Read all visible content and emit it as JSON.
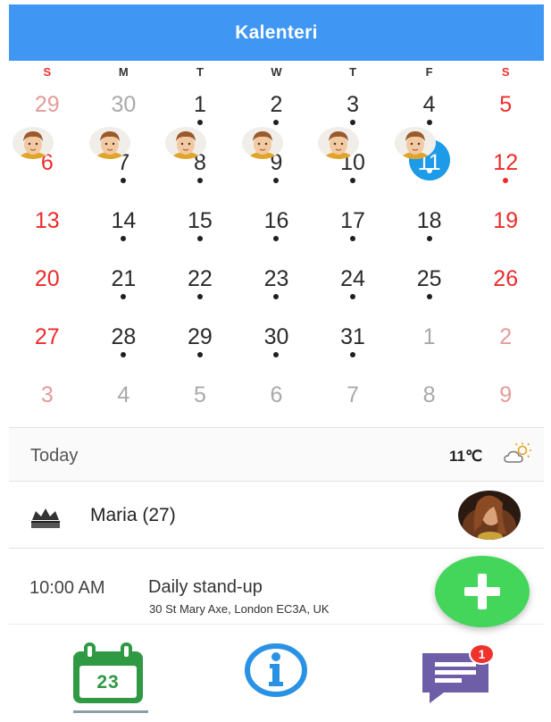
{
  "app": {
    "title": "Kalenteri"
  },
  "colors": {
    "appbar": "#3f97f3",
    "weekend": "#ee2b2b",
    "today_circle": "#1e9be8",
    "fab": "#44d65a",
    "calendar_icon": "#2f9944",
    "info_icon": "#2a92e4",
    "message_icon": "#6e5ea8",
    "badge": "#f0322e"
  },
  "weekdays": [
    "S",
    "M",
    "T",
    "W",
    "T",
    "F",
    "S"
  ],
  "calendar": {
    "weeks": [
      [
        {
          "d": "29",
          "out": true
        },
        {
          "d": "30",
          "out": true
        },
        {
          "d": "1",
          "dot": true
        },
        {
          "d": "2",
          "dot": true
        },
        {
          "d": "3",
          "dot": true
        },
        {
          "d": "4",
          "dot": true
        },
        {
          "d": "5"
        }
      ],
      [
        {
          "d": "6",
          "avatar": true
        },
        {
          "d": "7",
          "dot": true,
          "avatar": true
        },
        {
          "d": "8",
          "dot": true,
          "avatar": true
        },
        {
          "d": "9",
          "dot": true,
          "avatar": true
        },
        {
          "d": "10",
          "dot": true,
          "avatar": true
        },
        {
          "d": "11",
          "dot": true,
          "avatar": true,
          "today": true
        },
        {
          "d": "12",
          "dot": true
        }
      ],
      [
        {
          "d": "13"
        },
        {
          "d": "14",
          "dot": true
        },
        {
          "d": "15",
          "dot": true
        },
        {
          "d": "16",
          "dot": true
        },
        {
          "d": "17",
          "dot": true
        },
        {
          "d": "18",
          "dot": true
        },
        {
          "d": "19"
        }
      ],
      [
        {
          "d": "20"
        },
        {
          "d": "21",
          "dot": true
        },
        {
          "d": "22",
          "dot": true
        },
        {
          "d": "23",
          "dot": true
        },
        {
          "d": "24",
          "dot": true
        },
        {
          "d": "25",
          "dot": true
        },
        {
          "d": "26"
        }
      ],
      [
        {
          "d": "27"
        },
        {
          "d": "28",
          "dot": true
        },
        {
          "d": "29",
          "dot": true
        },
        {
          "d": "30",
          "dot": true
        },
        {
          "d": "31",
          "dot": true
        },
        {
          "d": "1",
          "out": true
        },
        {
          "d": "2",
          "out": true
        }
      ],
      [
        {
          "d": "3",
          "out": true
        },
        {
          "d": "4",
          "out": true
        },
        {
          "d": "5",
          "out": true
        },
        {
          "d": "6",
          "out": true
        },
        {
          "d": "7",
          "out": true
        },
        {
          "d": "8",
          "out": true
        },
        {
          "d": "9",
          "out": true
        }
      ]
    ]
  },
  "today_row": {
    "label": "Today",
    "temperature": "11℃",
    "weather_icon": "partly-cloudy-icon"
  },
  "birthday": {
    "icon": "crown-icon",
    "name": "Maria (27)"
  },
  "event": {
    "time": "10:00 AM",
    "title": "Daily stand-up",
    "location": "30 St Mary Axe, London EC3A, UK"
  },
  "fab": {
    "icon": "plus-icon"
  },
  "bottom_nav": {
    "calendar_day": "23",
    "calendar_icon": "calendar-icon",
    "info_icon": "info-icon",
    "messages_icon": "messages-icon",
    "messages_badge": "1"
  }
}
